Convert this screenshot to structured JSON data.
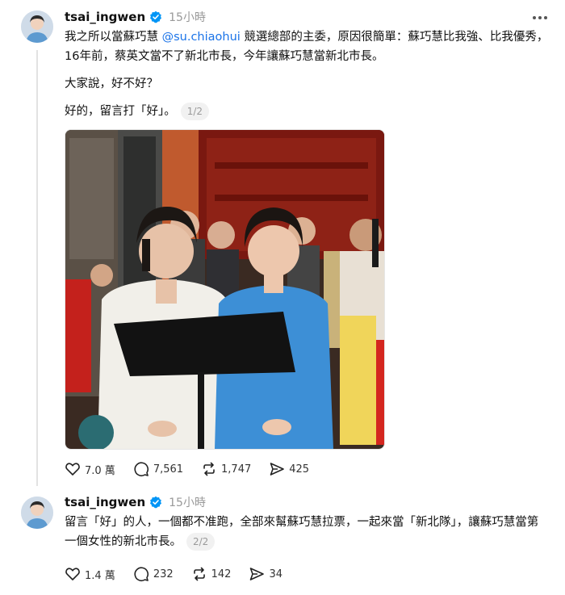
{
  "colors": {
    "verified": "#0095f6",
    "mention": "#1a73e8",
    "muted_text": "#999999",
    "thread_line": "#e2e2e2"
  },
  "post1": {
    "username": "tsai_ingwen",
    "time": "15小時",
    "text_before_mention": "我之所以當蘇巧慧 ",
    "mention": "@su.chiaohui",
    "text_after_mention": " 競選總部的主委，原因很簡單：蘇巧慧比我強、比我優秀，16年前，蔡英文當不了新北市長，今年讓蘇巧慧當新北市長。",
    "line2": "大家說，好不好？",
    "line3": "好的，留言打「好」。",
    "counter": "1/2",
    "likes": "7.0 萬",
    "comments": "7,561",
    "reposts": "1,747",
    "shares": "425"
  },
  "post2": {
    "username": "tsai_ingwen",
    "time": "15小時",
    "text": "留言「好」的人，一個都不准跑，全部來幫蘇巧慧拉票，一起來當「新北隊」，讓蘇巧慧當第一個女性的新北市長。",
    "counter": "2/2",
    "likes": "1.4 萬",
    "comments": "232",
    "reposts": "142",
    "shares": "34"
  },
  "icons": {
    "verified": "verified-badge-icon",
    "more": "more-dots-icon",
    "like": "heart-icon",
    "comment": "comment-bubble-icon",
    "repost": "repost-icon",
    "share": "share-arrow-icon"
  }
}
